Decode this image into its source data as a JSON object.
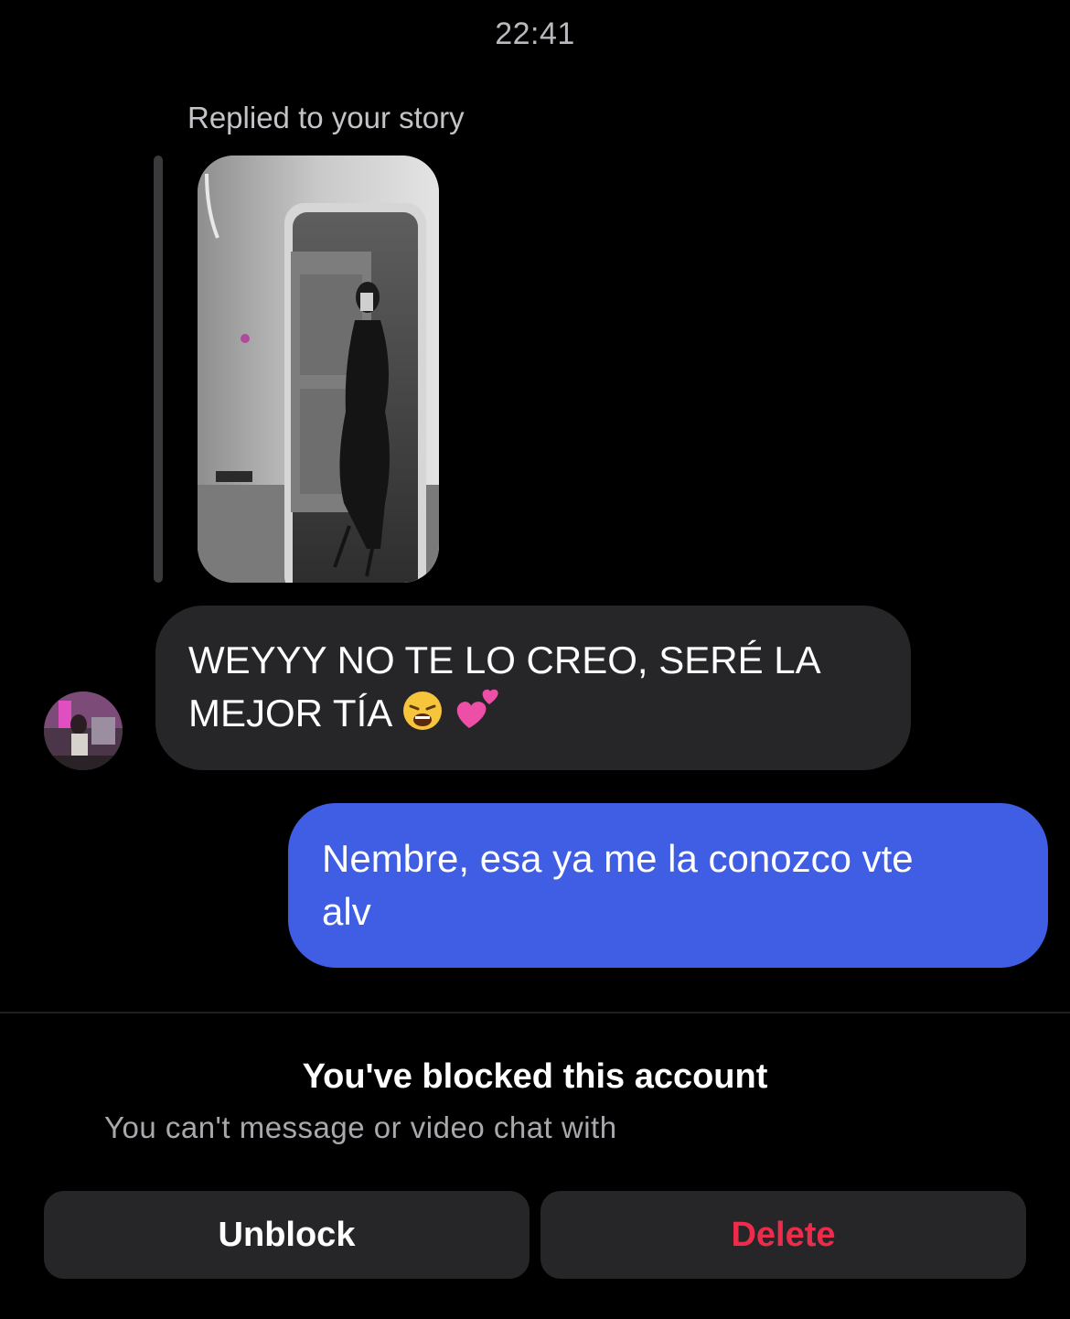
{
  "header": {
    "time": "22:41"
  },
  "story_reply": {
    "caption": "Replied to your story",
    "thumbnail": "story-photo-mirror-selfie"
  },
  "messages": [
    {
      "direction": "incoming",
      "line1": "WEYYY NO TE LO CREO, SERÉ LA",
      "line2": "MEJOR TÍA",
      "emojis": [
        "weary-face-emoji",
        "two-hearts-emoji"
      ]
    },
    {
      "direction": "outgoing",
      "line1": "Nembre, esa ya me la conozco vte",
      "line2": "alv"
    }
  ],
  "blocked_banner": {
    "title": "You've blocked this account",
    "subtitle": "You can't message or video chat with"
  },
  "actions": {
    "unblock_label": "Unblock",
    "delete_label": "Delete"
  },
  "colors": {
    "background": "#000000",
    "incoming_bubble": "#262628",
    "outgoing_bubble": "#3f5ee4",
    "delete_red": "#ed2c4c",
    "button_bg": "#262628"
  }
}
